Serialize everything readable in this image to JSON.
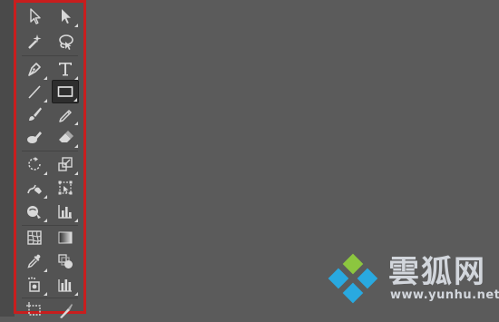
{
  "toolbar": {
    "rows": [
      {
        "left": "selection-tool",
        "right": "direct-selection-tool"
      },
      {
        "left": "magic-wand-tool",
        "right": "lasso-tool"
      },
      {
        "left": "pen-tool",
        "right": "type-tool"
      },
      {
        "left": "line-segment-tool",
        "right": "rectangle-tool",
        "active": "right"
      },
      {
        "left": "paintbrush-tool",
        "right": "pencil-tool"
      },
      {
        "left": "blob-brush-tool",
        "right": "eraser-tool"
      },
      {
        "left": "rotate-tool",
        "right": "scale-tool"
      },
      {
        "left": "warp-tool",
        "right": "free-transform-tool"
      },
      {
        "left": "symbol-sprayer-tool",
        "right": "column-graph-tool"
      },
      {
        "left": "mesh-tool",
        "right": "gradient-tool"
      },
      {
        "left": "eyedropper-tool",
        "right": "blend-tool"
      },
      {
        "left": "live-paint-bucket-tool",
        "right": "column-graph-tool-alt"
      },
      {
        "left": "artboard-tool",
        "right": "slice-tool"
      }
    ]
  },
  "watermark": {
    "title": "雲狐网",
    "url": "www.yunhu.net",
    "colors": {
      "text": "#d2d6dc",
      "green": "#8cc63f",
      "blue": "#29a9e0"
    }
  },
  "colors": {
    "background": "#5b5b5b",
    "panel": "#535353",
    "outline": "#c81e1e",
    "icon": "#d8d8d8"
  }
}
